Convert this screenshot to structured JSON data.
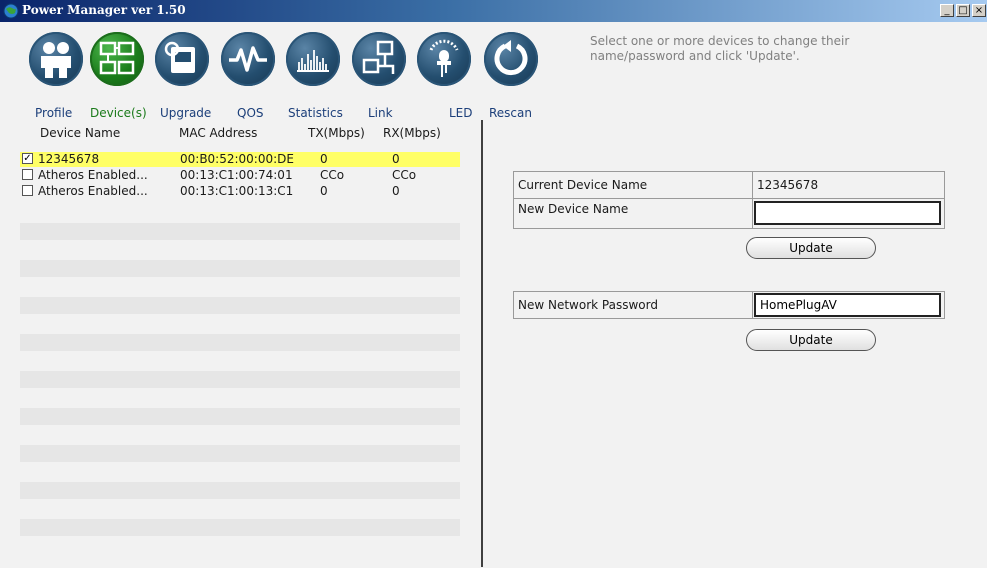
{
  "window": {
    "title": "Power Manager ver 1.50",
    "controls": [
      "_",
      "□",
      "×"
    ]
  },
  "toolbar": {
    "items": [
      {
        "label": "Profile",
        "icon": "people-icon",
        "active": false
      },
      {
        "label": "Device(s)",
        "icon": "devices-icon",
        "active": true
      },
      {
        "label": "Upgrade",
        "icon": "upgrade-icon",
        "active": false
      },
      {
        "label": "QOS",
        "icon": "waveform-icon",
        "active": false
      },
      {
        "label": "Statistics",
        "icon": "bar-chart-icon",
        "active": false
      },
      {
        "label": "Link",
        "icon": "network-link-icon",
        "active": false
      },
      {
        "label": "LED",
        "icon": "led-icon",
        "active": false
      },
      {
        "label": "Rescan",
        "icon": "rescan-icon",
        "active": false
      }
    ],
    "hint": "Select one or more devices to change their name/password and click 'Update'."
  },
  "device_list": {
    "columns": [
      "Device Name",
      "MAC Address",
      "TX(Mbps)",
      "RX(Mbps)"
    ],
    "rows": [
      {
        "checked": true,
        "name": "12345678",
        "mac": "00:B0:52:00:00:DE",
        "tx": "0",
        "rx": "0",
        "selected": true
      },
      {
        "checked": false,
        "name": "Atheros Enabled...",
        "mac": "00:13:C1:00:74:01",
        "tx": "CCo",
        "rx": "CCo",
        "selected": false
      },
      {
        "checked": false,
        "name": "Atheros Enabled...",
        "mac": "00:13:C1:00:13:C1",
        "tx": "0",
        "rx": "0",
        "selected": false
      }
    ]
  },
  "device_panel": {
    "current_name_label": "Current Device Name",
    "current_name_value": "12345678",
    "new_name_label": "New Device Name",
    "new_name_value": "",
    "update_label": "Update",
    "password_label": "New Network Password",
    "password_value": "HomePlugAV",
    "update_password_label": "Update"
  },
  "colors": {
    "titlebar_dark": "#0a246a",
    "selected_row": "#ffff66",
    "icon_blue": "#244e6f",
    "icon_green": "#1b7d1b"
  }
}
